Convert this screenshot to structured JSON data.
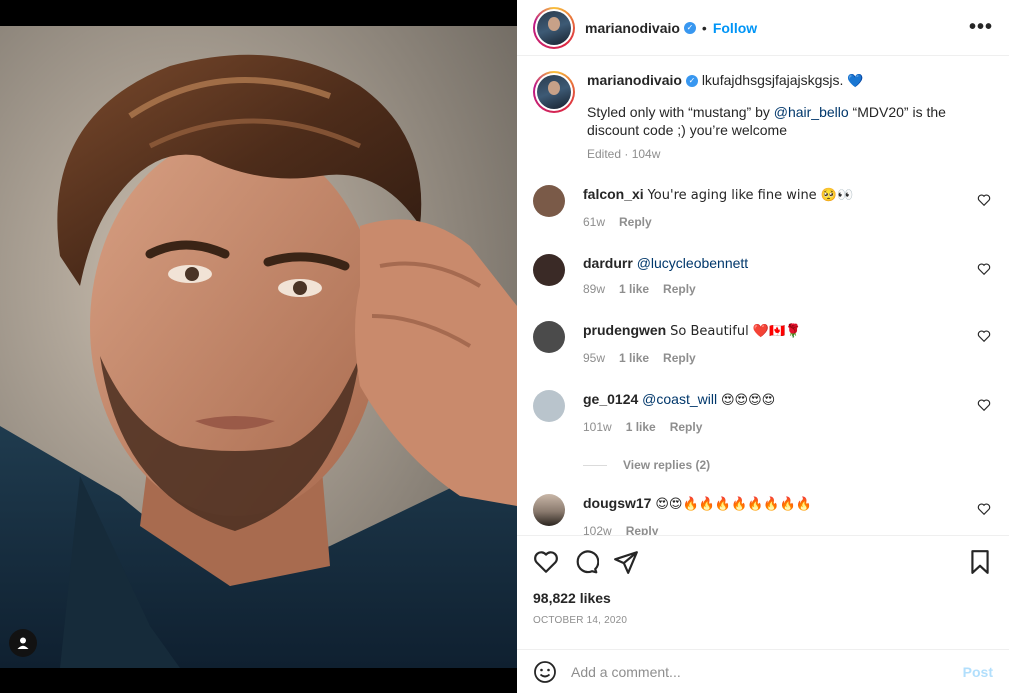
{
  "post": {
    "username": "marianodivaio",
    "follow_label": "Follow",
    "dot": "•",
    "more_label": "•••",
    "caption_first": "lkufajdhsgsjfajajskgsjs.",
    "caption_heart": "💙",
    "caption_line2_a": "Styled only with “mustang” by ",
    "caption_mention": "@hair_bello",
    "caption_line2_b": " “MDV20” is the discount code ;) you’re welcome",
    "caption_meta": "Edited · 104w",
    "likes": "98,822 likes",
    "date": "OCTOBER 14, 2020"
  },
  "comments": [
    {
      "user": "falcon_xi",
      "text": "You're aging like fine wine 🥺👀",
      "mention": "",
      "age": "61w",
      "likes": "",
      "reply": "Reply",
      "avatar_color": "#7a5a48"
    },
    {
      "user": "dardurr",
      "text": "",
      "mention": "@lucycleobennett",
      "age": "89w",
      "likes": "1 like",
      "reply": "Reply",
      "avatar_color": "#3a2a26"
    },
    {
      "user": "prudengwen",
      "text": "So Beautiful ❤️🇨🇦🌹",
      "mention": "",
      "age": "95w",
      "likes": "1 like",
      "reply": "Reply",
      "avatar_color": "#4b4b4b"
    },
    {
      "user": "ge_0124",
      "text": "😍😍😍😍",
      "mention": "@coast_will",
      "age": "101w",
      "likes": "1 like",
      "reply": "Reply",
      "avatar_color": "#b9c4cc"
    },
    {
      "user": "dougsw17",
      "text": "😍😍🔥🔥🔥🔥🔥🔥🔥🔥",
      "mention": "",
      "age": "102w",
      "likes": "",
      "reply": "Reply",
      "avatar_color": "#8a7a6e"
    }
  ],
  "view_replies": "View replies (2)",
  "composer": {
    "placeholder": "Add a comment...",
    "post_label": "Post"
  },
  "colors": {
    "accent": "#0095f6",
    "verified": "#3897f0",
    "muted": "#8e8e8e"
  },
  "icons": [
    "user-tag-icon",
    "verified-icon",
    "more-icon",
    "heart-icon",
    "comment-icon",
    "share-icon",
    "bookmark-icon",
    "emoji-icon"
  ]
}
